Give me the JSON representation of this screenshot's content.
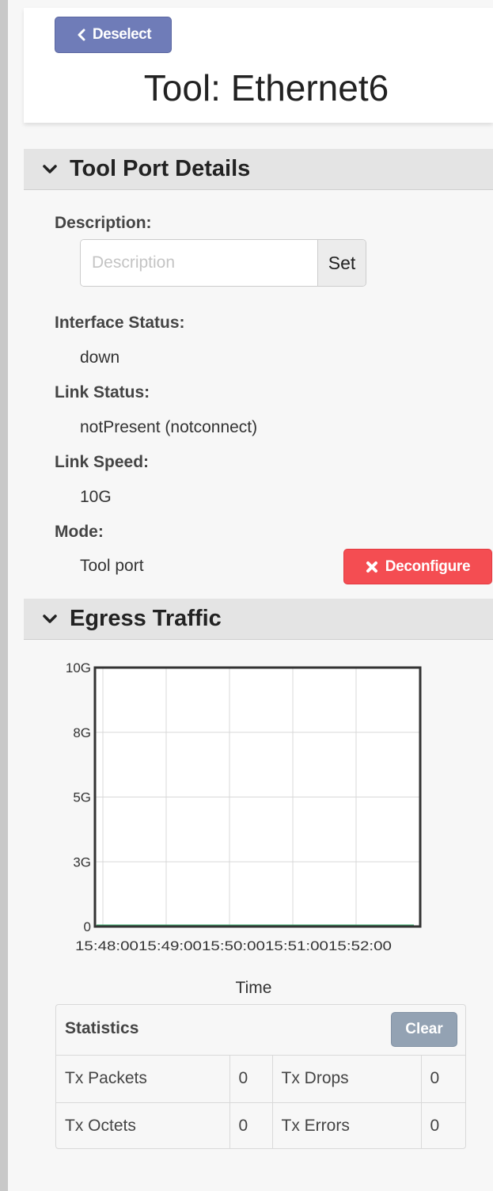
{
  "header": {
    "deselect_label": "Deselect",
    "title": "Tool: Ethernet6"
  },
  "tool_port_details": {
    "section_title": "Tool Port Details",
    "description_label": "Description:",
    "description_placeholder": "Description",
    "description_value": "",
    "set_label": "Set",
    "interface_status_label": "Interface Status:",
    "interface_status_value": "down",
    "link_status_label": "Link Status:",
    "link_status_value": "notPresent (notconnect)",
    "link_speed_label": "Link Speed:",
    "link_speed_value": "10G",
    "mode_label": "Mode:",
    "mode_value": "Tool port",
    "deconfigure_label": "Deconfigure"
  },
  "egress_traffic": {
    "section_title": "Egress Traffic"
  },
  "chart_data": {
    "type": "line",
    "title": "",
    "xlabel": "Time",
    "ylabel": "",
    "x_tick_labels": [
      "15:48:00",
      "15:49:00",
      "15:50:00",
      "15:51:00",
      "15:52:00"
    ],
    "y_tick_labels": [
      "0",
      "3G",
      "5G",
      "8G",
      "10G"
    ],
    "y_tick_values": [
      0,
      2500000000,
      5000000000,
      7500000000,
      10000000000
    ],
    "ylim": [
      0,
      10000000000
    ],
    "grid": true,
    "series": [
      {
        "color": "#3cb371",
        "x": [
          "15:48:00",
          "15:49:00",
          "15:50:00",
          "15:51:00",
          "15:52:00"
        ],
        "values": [
          0,
          0,
          0,
          0,
          0
        ]
      }
    ]
  },
  "statistics": {
    "title": "Statistics",
    "clear_label": "Clear",
    "rows": [
      {
        "label_a": "Tx Packets",
        "value_a": "0",
        "label_b": "Tx Drops",
        "value_b": "0"
      },
      {
        "label_a": "Tx Octets",
        "value_a": "0",
        "label_b": "Tx Errors",
        "value_b": "0"
      }
    ]
  },
  "colors": {
    "deselect": "#6f7cb8",
    "deconfigure": "#f44d52",
    "clear": "#93a2b3",
    "series_line": "#3cb371"
  }
}
